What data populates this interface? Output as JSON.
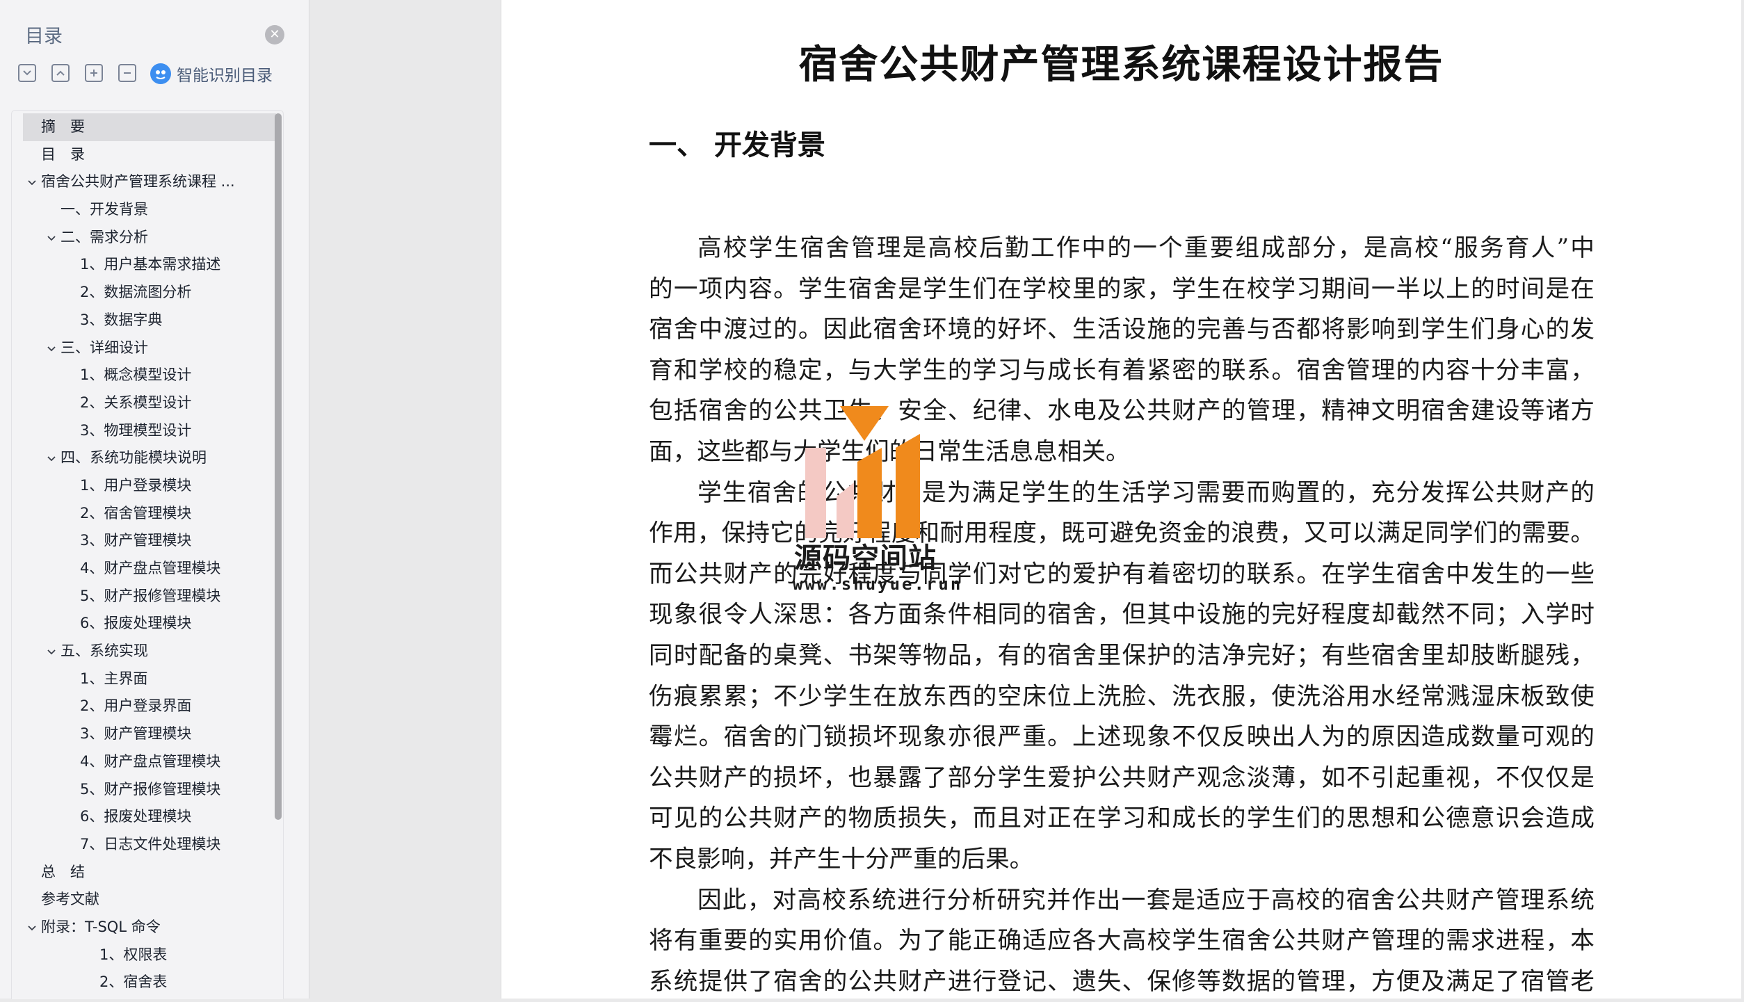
{
  "toc": {
    "title": "目录",
    "smart_label": "智能识别目录",
    "items": [
      {
        "label": "摘　要",
        "level": 0,
        "chevron": false,
        "selected": true
      },
      {
        "label": "目　录",
        "level": 0,
        "chevron": false
      },
      {
        "label": "宿舍公共财产管理系统课程 ...",
        "level": 0,
        "chevron": true
      },
      {
        "label": "一、开发背景",
        "level": 1,
        "chevron": false
      },
      {
        "label": "二、需求分析",
        "level": 1,
        "chevron": true
      },
      {
        "label": "1、用户基本需求描述",
        "level": 2,
        "chevron": false
      },
      {
        "label": "2、数据流图分析",
        "level": 2,
        "chevron": false
      },
      {
        "label": "3、数据字典",
        "level": 2,
        "chevron": false
      },
      {
        "label": "三、详细设计",
        "level": 1,
        "chevron": true
      },
      {
        "label": "1、概念模型设计",
        "level": 2,
        "chevron": false
      },
      {
        "label": "2、关系模型设计",
        "level": 2,
        "chevron": false
      },
      {
        "label": "3、物理模型设计",
        "level": 2,
        "chevron": false
      },
      {
        "label": "四、系统功能模块说明",
        "level": 1,
        "chevron": true
      },
      {
        "label": "1、用户登录模块",
        "level": 2,
        "chevron": false
      },
      {
        "label": "2、宿舍管理模块",
        "level": 2,
        "chevron": false
      },
      {
        "label": "3、财产管理模块",
        "level": 2,
        "chevron": false
      },
      {
        "label": "4、财产盘点管理模块",
        "level": 2,
        "chevron": false
      },
      {
        "label": "5、财产报修管理模块",
        "level": 2,
        "chevron": false
      },
      {
        "label": "6、报废处理模块",
        "level": 2,
        "chevron": false
      },
      {
        "label": "五、系统实现",
        "level": 1,
        "chevron": true
      },
      {
        "label": "1、主界面",
        "level": 2,
        "chevron": false
      },
      {
        "label": "2、用户登录界面",
        "level": 2,
        "chevron": false
      },
      {
        "label": "3、财产管理模块",
        "level": 2,
        "chevron": false
      },
      {
        "label": "4、财产盘点管理模块",
        "level": 2,
        "chevron": false
      },
      {
        "label": "5、财产报修管理模块",
        "level": 2,
        "chevron": false
      },
      {
        "label": "6、报废处理模块",
        "level": 2,
        "chevron": false
      },
      {
        "label": "7、日志文件处理模块",
        "level": 2,
        "chevron": false
      },
      {
        "label": "总　结",
        "level": 0,
        "chevron": false
      },
      {
        "label": "参考文献",
        "level": 0,
        "chevron": false
      },
      {
        "label": "附录：T-SQL 命令",
        "level": 0,
        "chevron": true
      },
      {
        "label": "1、权限表",
        "level": 3,
        "chevron": false
      },
      {
        "label": "2、宿舍表",
        "level": 3,
        "chevron": false
      }
    ]
  },
  "document": {
    "title": "宿舍公共财产管理系统课程设计报告",
    "section_heading": "一、 开发背景",
    "lines": [
      {
        "text": "高校学生宿舍管理是高校后勤工作中的一个重要组成部分，是高校“服务育人”中",
        "indent": true
      },
      {
        "text": "的一项内容。学生宿舍是学生们在学校里的家，学生在校学习期间一半以上的时间是在"
      },
      {
        "text": "宿舍中渡过的。因此宿舍环境的好坏、生活设施的完善与否都将影响到学生们身心的发"
      },
      {
        "text": "育和学校的稳定，与大学生的学习与成长有着紧密的联系。宿舍管理的内容十分丰富，"
      },
      {
        "text": "包括宿舍的公共卫生、安全、纪律、水电及公共财产的管理，精神文明宿舍建设等诸方"
      },
      {
        "text": "面，这些都与大学生们的日常生活息息相关。",
        "last": true
      },
      {
        "text": "学生宿舍的公共财产是为满足学生的生活学习需要而购置的，充分发挥公共财产的",
        "indent": true
      },
      {
        "text": "作用，保持它的完好程度和耐用程度，既可避免资金的浪费，又可以满足同学们的需要。"
      },
      {
        "text": "而公共财产的完好程度与同学们对它的爱护有着密切的联系。在学生宿舍中发生的一些"
      },
      {
        "text": "现象很令人深思：各方面条件相同的宿舍，但其中设施的完好程度却截然不同；入学时"
      },
      {
        "text": "同时配备的桌凳、书架等物品，有的宿舍里保护的洁净完好；有些宿舍里却肢断腿残，"
      },
      {
        "text": "伤痕累累；不少学生在放东西的空床位上洗脸、洗衣服，使洗浴用水经常溅湿床板致使"
      },
      {
        "text": "霉烂。宿舍的门锁损坏现象亦很严重。上述现象不仅反映出人为的原因造成数量可观的"
      },
      {
        "text": "公共财产的损坏，也暴露了部分学生爱护公共财产观念淡薄，如不引起重视，不仅仅是"
      },
      {
        "text": "可见的公共财产的物质损失，而且对正在学习和成长的学生们的思想和公德意识会造成"
      },
      {
        "text": "不良影响，并产生十分严重的后果。",
        "last": true
      },
      {
        "text": "因此，对高校系统进行分析研究并作出一套是适应于高校的宿舍公共财产管理系统",
        "indent": true
      },
      {
        "text": "将有重要的实用价值。为了能正确适应各大高校学生宿舍公共财产管理的需求进程，本"
      },
      {
        "text": "系统提供了宿舍的公共财产进行登记、遗失、保修等数据的管理，方便及满足了宿管老"
      }
    ]
  },
  "watermark": {
    "text": "源码空间站",
    "url": "www.shuyue.run",
    "colors": {
      "orange": "#f08a1c",
      "pink": "#f4c9c4"
    }
  }
}
